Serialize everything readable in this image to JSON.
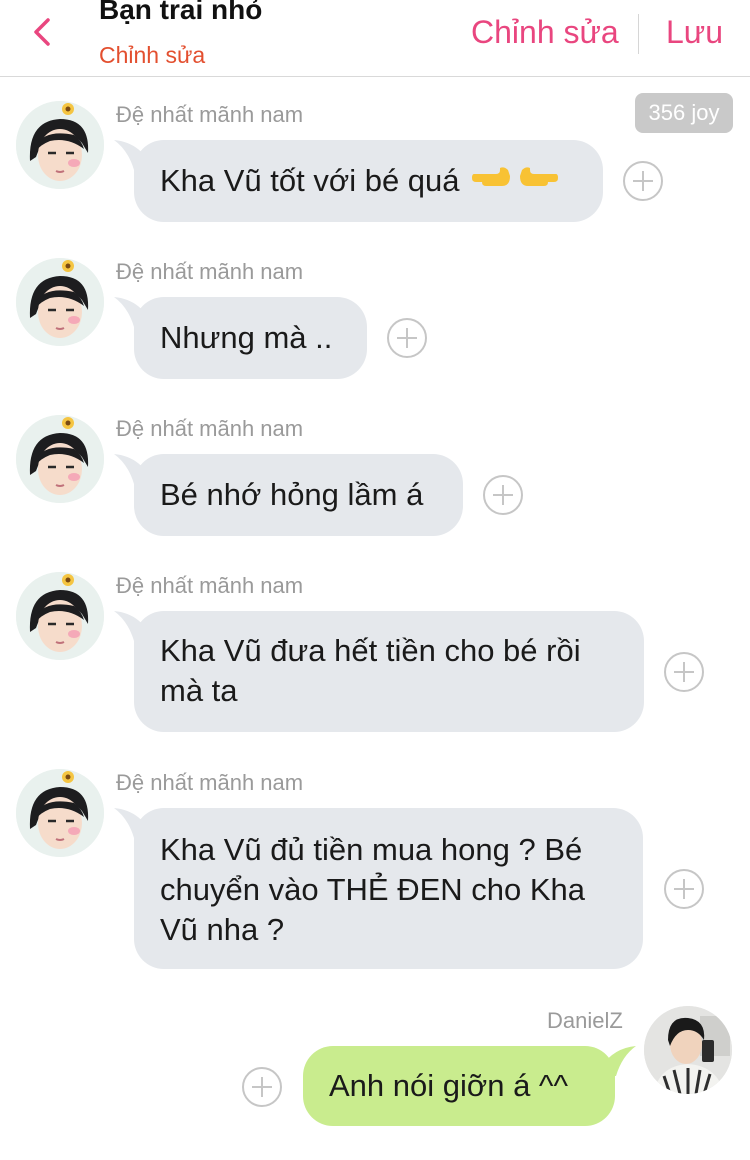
{
  "header": {
    "title": "Bạn trai nhỏ",
    "subtitle": "Chỉnh sửa",
    "edit_label": "Chỉnh sửa",
    "save_label": "Lưu"
  },
  "messages": [
    {
      "sender": "Đệ nhất mãnh nam",
      "text": "Kha Vũ tốt với bé quá",
      "emoji": "pointing-hands-icon",
      "badge": "356 joy"
    },
    {
      "sender": "Đệ nhất mãnh nam",
      "text": "Nhưng mà .."
    },
    {
      "sender": "Đệ nhất mãnh nam",
      "text": "Bé nhớ hỏng lầm á"
    },
    {
      "sender": "Đệ nhất mãnh nam",
      "lines": [
        "Kha Vũ đưa hết tiền cho bé rồi",
        "mà ta"
      ]
    },
    {
      "sender": "Đệ nhất mãnh nam",
      "lines": [
        "Kha Vũ đủ tiền mua hong ? Bé",
        "chuyển vào THẺ ĐEN cho Kha",
        "Vũ nha ?"
      ]
    },
    {
      "sender": "DanielZ",
      "text": "Anh nói giỡn á ^^"
    }
  ],
  "colors": {
    "accent": "#e9467f",
    "subtitle": "#e34f2f",
    "bubble_gray": "#e5e8ec",
    "bubble_green": "#c9ec8e"
  }
}
